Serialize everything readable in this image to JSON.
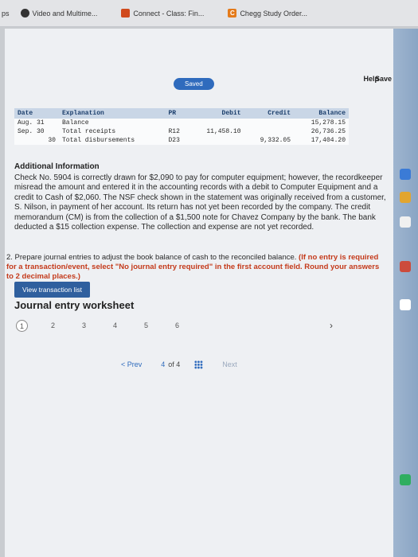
{
  "bookmarks": {
    "items": [
      {
        "label": "Video and Multime...",
        "icon": "video-icon"
      },
      {
        "label": "Connect - Class: Fin...",
        "icon": "connect-icon"
      },
      {
        "label": "Chegg Study Order...",
        "icon": "chegg-icon",
        "glyph": "C"
      }
    ],
    "leading": "ps"
  },
  "header": {
    "help": "Help",
    "save": "Save",
    "saved": "Saved"
  },
  "ledger": {
    "headers": [
      "Date",
      "Explanation",
      "PR",
      "Debit",
      "Credit",
      "Balance"
    ],
    "rows": [
      [
        "Aug. 31",
        "Balance",
        "",
        "",
        "",
        "15,278.15"
      ],
      [
        "Sep. 30",
        "Total receipts",
        "R12",
        "11,458.10",
        "",
        "26,736.25"
      ],
      [
        "30",
        "Total disbursements",
        "D23",
        "",
        "9,332.05",
        "17,404.20"
      ]
    ]
  },
  "additional": {
    "title": "Additional Information",
    "body": "Check No. 5904 is correctly drawn for $2,090 to pay for computer equipment; however, the recordkeeper misread the amount and entered it in the accounting records with a debit to Computer Equipment and a credit to Cash of $2,060. The NSF check shown in the statement was originally received from a customer, S. Nilson, in payment of her account. Its return has not yet been recorded by the company. The credit memorandum (CM) is from the collection of a $1,500 note for Chavez Company by the bank. The bank deducted a $15 collection expense. The collection and expense are not yet recorded."
  },
  "instructions": {
    "text": "2. Prepare journal entries to adjust the book balance of cash to the reconciled balance.",
    "highlight": "(If no entry is required for a transaction/event, select \"No journal entry required\" in the first account field. Round your answers to 2 decimal places.)"
  },
  "view_button": "View transaction list",
  "worksheet": {
    "title": "Journal entry worksheet",
    "pages": [
      "1",
      "2",
      "3",
      "4",
      "5",
      "6"
    ],
    "active_page": "1"
  },
  "nav": {
    "prev": "< Prev",
    "current": "4",
    "of": "of 4",
    "next": "Next"
  },
  "colors": {
    "accent": "#2f6bbd",
    "warning": "#c43a1b"
  }
}
